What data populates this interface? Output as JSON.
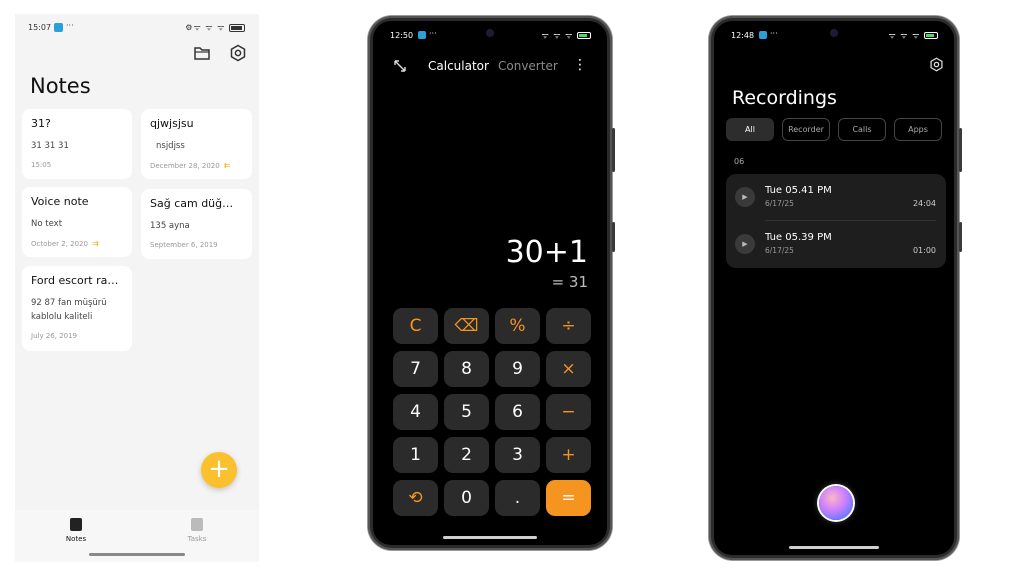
{
  "notes_app": {
    "status": {
      "time": "15:07",
      "dots": "···",
      "right": "⚙ᯤ ᯤ ᯤ"
    },
    "title": "Notes",
    "notes": [
      {
        "title": "31?",
        "body": "31 31 31",
        "date": "15:05",
        "mark": ""
      },
      {
        "title": "qjwjsjsu",
        "body": "nsjdjss",
        "date": "December 28, 2020",
        "mark": "⇇"
      },
      {
        "title": "Voice note",
        "body": "No text",
        "date": "October 2, 2020",
        "mark": "⇉"
      },
      {
        "title": "Sağ cam düğme...",
        "body": "135 ayna",
        "date": "September 6, 2019",
        "mark": ""
      },
      {
        "title": "Ford escort rady...",
        "body": "92 87 fan müşürü kablolu kaliteli",
        "date": "July 26, 2019",
        "mark": ""
      }
    ],
    "fab_label": "+",
    "nav": {
      "notes_label": "Notes",
      "tasks_label": "Tasks"
    },
    "colors": {
      "accent": "#fbc02d"
    }
  },
  "calculator_app": {
    "status": {
      "time": "12:50",
      "dots": "···",
      "right": "ᯤ ᯤ ᯤ"
    },
    "tabs": {
      "active": "Calculator",
      "other": "Converter"
    },
    "more": "⋮",
    "expression": "30+1",
    "result": "= 31",
    "keys": [
      "C",
      "⌫",
      "%",
      "÷",
      "7",
      "8",
      "9",
      "×",
      "4",
      "5",
      "6",
      "−",
      "1",
      "2",
      "3",
      "+",
      "⟲",
      "0",
      ".",
      "="
    ],
    "colors": {
      "operator": "#f5941e"
    }
  },
  "recorder_app": {
    "status": {
      "time": "12:48",
      "dots": "···",
      "right": "ᯤ ᯤ ᯤ"
    },
    "title": "Recordings",
    "filters": [
      "All",
      "Recorder",
      "Calls",
      "Apps"
    ],
    "group_label": "06",
    "recordings": [
      {
        "name": "Tue 05.41 PM",
        "date": "6/17/25",
        "duration": "24:04"
      },
      {
        "name": "Tue 05.39 PM",
        "date": "6/17/25",
        "duration": "01:00"
      }
    ]
  }
}
